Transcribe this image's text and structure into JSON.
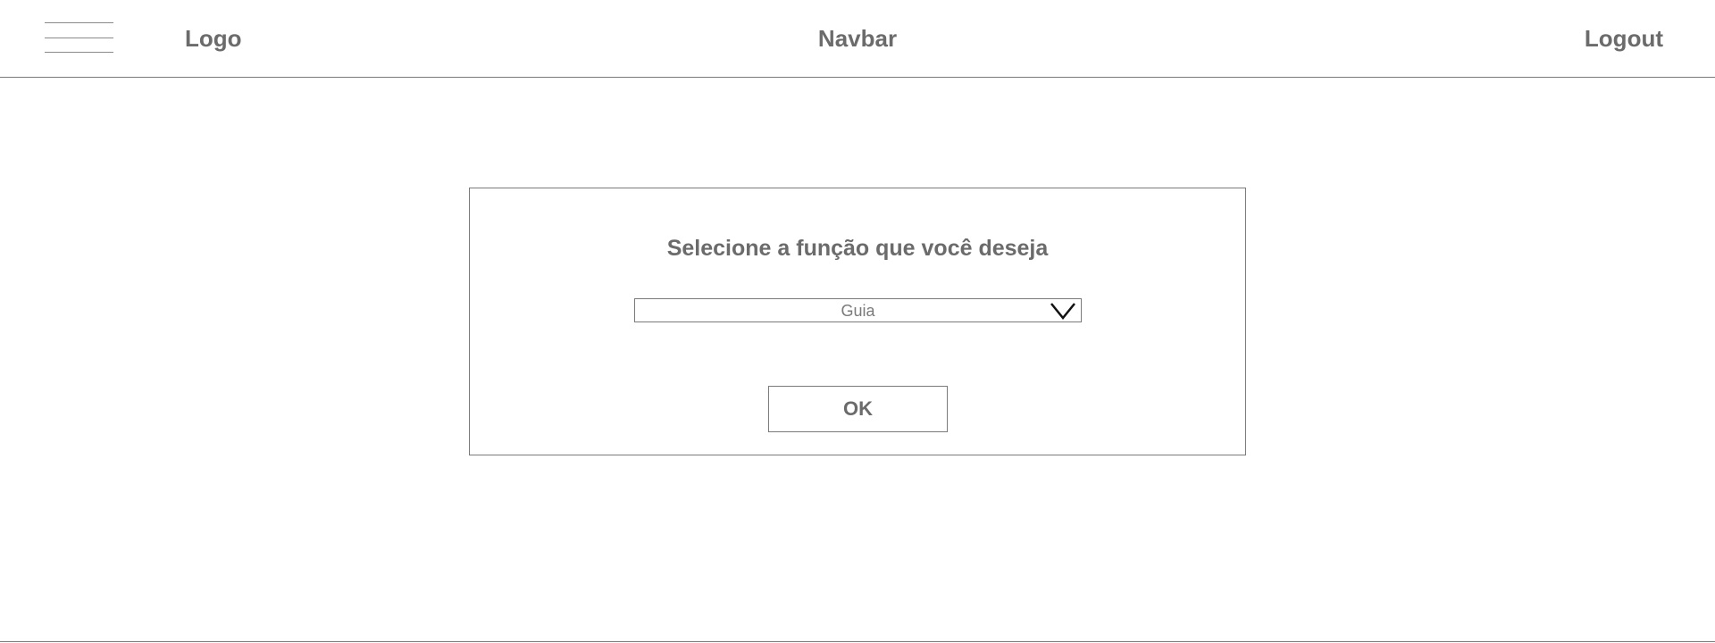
{
  "navbar": {
    "menu_icon": "hamburger-menu-icon",
    "logo_label": "Logo",
    "title": "Navbar",
    "logout_label": "Logout"
  },
  "dialog": {
    "title": "Selecione a função que você deseja",
    "select": {
      "selected_value": "Guia",
      "icon": "chevron-down-icon"
    },
    "ok_label": "OK"
  },
  "colors": {
    "text": "#6b6b6b",
    "border": "#7a7a7a",
    "background": "#ffffff"
  }
}
